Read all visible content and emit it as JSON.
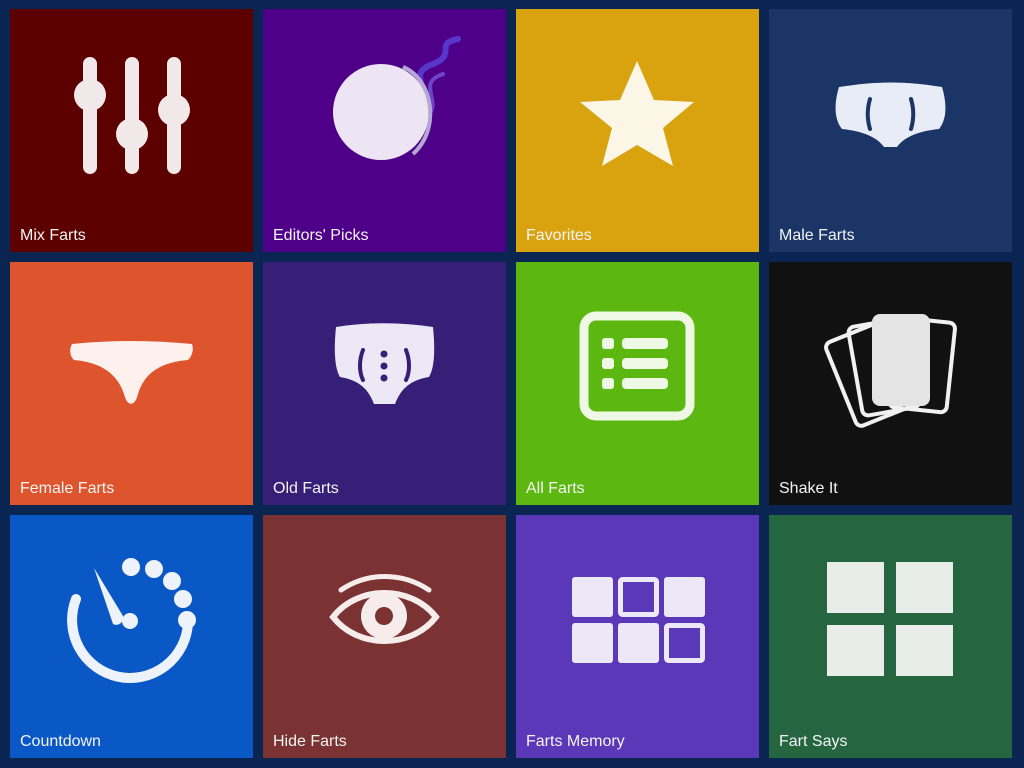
{
  "tiles": [
    {
      "label": "Mix Farts",
      "icon": "sliders-icon",
      "color": "#5c0000"
    },
    {
      "label": "Editors' Picks",
      "icon": "bottom-icon",
      "color": "#4f0089"
    },
    {
      "label": "Favorites",
      "icon": "star-icon",
      "color": "#d9a30f"
    },
    {
      "label": "Male Farts",
      "icon": "briefs-icon",
      "color": "#1a3566"
    },
    {
      "label": "Female Farts",
      "icon": "thong-icon",
      "color": "#de552d"
    },
    {
      "label": "Old Farts",
      "icon": "old-briefs-icon",
      "color": "#371e76"
    },
    {
      "label": "All Farts",
      "icon": "list-icon",
      "color": "#5cb811"
    },
    {
      "label": "Shake It",
      "icon": "cards-icon",
      "color": "#111111"
    },
    {
      "label": "Countdown",
      "icon": "timer-icon",
      "color": "#0a57c6"
    },
    {
      "label": "Hide Farts",
      "icon": "eye-icon",
      "color": "#7a3232"
    },
    {
      "label": "Farts Memory",
      "icon": "memory-grid-icon",
      "color": "#5b38b8"
    },
    {
      "label": "Fart Says",
      "icon": "four-squares-icon",
      "color": "#256641"
    }
  ]
}
